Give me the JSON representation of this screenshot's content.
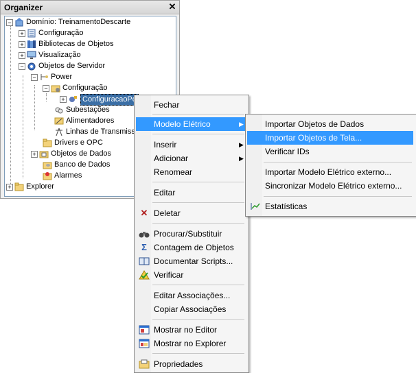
{
  "organizer": {
    "title": "Organizer",
    "close": "✕",
    "tree": {
      "root": "Domínio: TreinamentoDescarte",
      "configuracao": "Configuração",
      "bibliotecas": "Bibliotecas de Objetos",
      "visualizacao": "Visualização",
      "objetos_servidor": "Objetos de Servidor",
      "power": "Power",
      "power_config": "Configuração",
      "config_item": "ConfiguracaoPo",
      "subestacoes": "Subestações",
      "alimentadores": "Alimentadores",
      "linhas": "Linhas de Transmiss",
      "drivers": "Drivers e OPC",
      "objetos_dados": "Objetos de Dados",
      "banco": "Banco de Dados",
      "alarmes": "Alarmes",
      "explorer": "Explorer"
    }
  },
  "context_menu": {
    "fechar": "Fechar",
    "modelo_eletrico": "Modelo Elétrico",
    "inserir": "Inserir",
    "adicionar": "Adicionar",
    "renomear": "Renomear",
    "editar": "Editar",
    "deletar": "Deletar",
    "procurar": "Procurar/Substituir",
    "contagem": "Contagem de Objetos",
    "documentar": "Documentar Scripts...",
    "verificar": "Verificar",
    "editar_assoc": "Editar Associações...",
    "copiar_assoc": "Copiar Associações",
    "mostrar_editor": "Mostrar no Editor",
    "mostrar_explorer": "Mostrar no Explorer",
    "propriedades": "Propriedades"
  },
  "submenu": {
    "importar_dados": "Importar Objetos de Dados",
    "importar_tela": "Importar Objetos de Tela...",
    "verificar_ids": "Verificar IDs",
    "importar_modelo": "Importar Modelo Elétrico externo...",
    "sincronizar": "Sincronizar Modelo Elétrico externo...",
    "estatisticas": "Estatísticas"
  },
  "colors": {
    "highlight": "#3399ff",
    "selected_tree": "#3a6ea5"
  }
}
